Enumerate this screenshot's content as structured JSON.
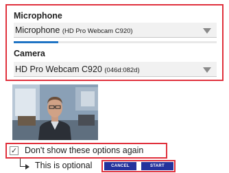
{
  "microphone": {
    "label": "Microphone",
    "selected_main": "Microphone",
    "selected_detail": "(HD Pro Webcam C920)",
    "input_level": 0.22
  },
  "camera": {
    "label": "Camera",
    "selected_main": "HD Pro Webcam C920",
    "selected_detail": "(046d:082d)"
  },
  "options": {
    "dont_show_label": "Don't show these options again",
    "dont_show_checked": true,
    "check_glyph": "✓",
    "optional_note": "This is optional"
  },
  "actions": {
    "cancel_label": "CANCEL",
    "start_label": "START"
  },
  "colors": {
    "highlight_border": "#e0303c",
    "button_bg": "#24329c",
    "level_fill": "#1f74c4"
  }
}
